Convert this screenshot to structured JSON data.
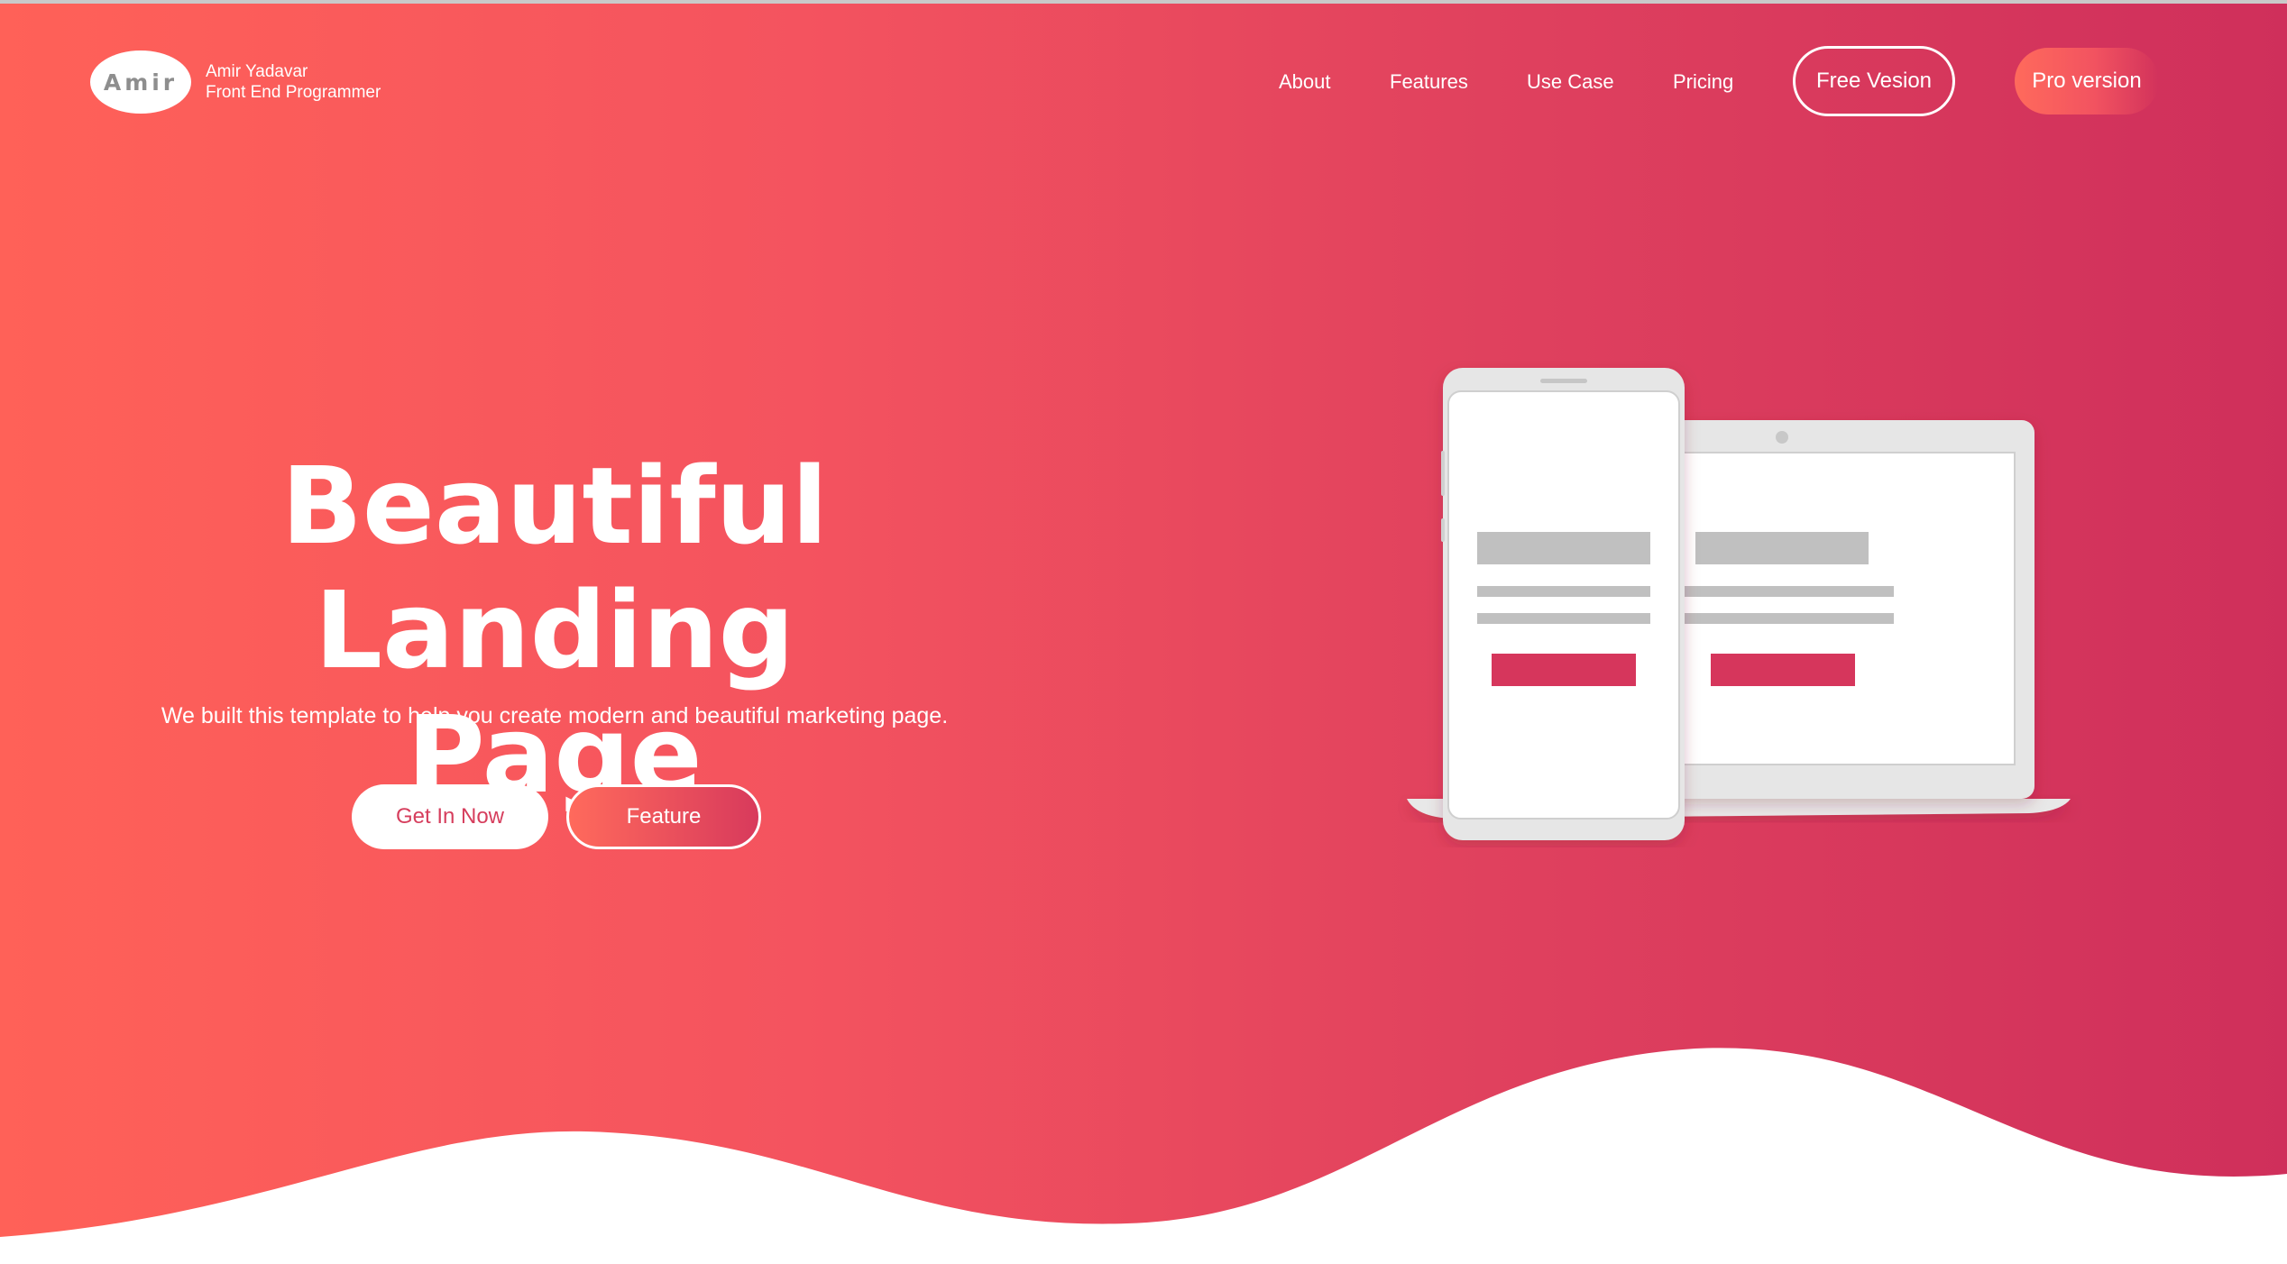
{
  "brand": {
    "logo_text": "Amir",
    "name": "Amir Yadavar",
    "role": "Front End Programmer"
  },
  "nav": {
    "links": [
      "About",
      "Features",
      "Use Case",
      "Pricing"
    ],
    "free_button": "Free Vesion",
    "pro_button": "Pro version"
  },
  "hero": {
    "title_line1": "Beautiful Landing",
    "title_line2": "Page",
    "subtitle": "We built this template to help you create modern and beautiful marketing page.",
    "primary_button": "Get In Now",
    "secondary_button": "Feature"
  },
  "illustration": {
    "icons": [
      "smartphone-icon",
      "laptop-icon"
    ]
  },
  "colors": {
    "gradient_start": "#ff6158",
    "gradient_end": "#cf2f5b",
    "accent": "#d83a5c",
    "placeholder_gray": "#c0c0c0"
  }
}
